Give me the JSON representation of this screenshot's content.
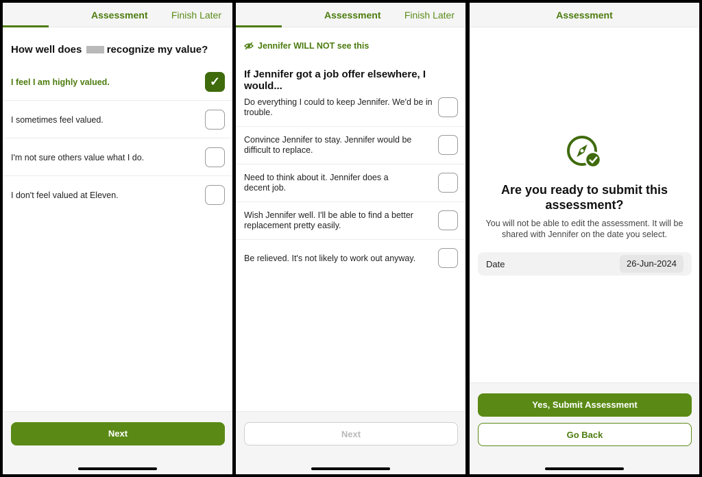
{
  "screens": [
    {
      "title": "Assessment",
      "finish_later": "Finish Later",
      "question_before": "How well does",
      "question_after": "recognize my value?",
      "options": [
        {
          "label": "I feel I am highly valued.",
          "checked": true
        },
        {
          "label": "I sometimes feel valued.",
          "checked": false
        },
        {
          "label": "I'm not sure others value what I do.",
          "checked": false
        },
        {
          "label": "I don't feel valued at Eleven.",
          "checked": false
        }
      ],
      "next_label": "Next"
    },
    {
      "title": "Assessment",
      "finish_later": "Finish Later",
      "visibility_notice": "Jennifer WILL NOT see this",
      "question": "If Jennifer got a job offer elsewhere, I would...",
      "options": [
        {
          "label": "Do everything I could to keep Jennifer. We'd be in trouble.",
          "checked": false
        },
        {
          "label": "Convince Jennifer to stay. Jennifer would be difficult to replace.",
          "checked": false
        },
        {
          "label": "Need to think about it. Jennifer does a decent job.",
          "checked": false
        },
        {
          "label": "Wish Jennifer well. I'll be able to find a better replacement pretty easily.",
          "checked": false
        },
        {
          "label": "Be relieved. It's not likely to work out anyway.",
          "checked": false
        }
      ],
      "next_label": "Next"
    },
    {
      "title": "Assessment",
      "heading": "Are you ready to submit this assessment?",
      "body": "You will not be able to edit the assessment. It will be shared with Jennifer on the date you select.",
      "date_label": "Date",
      "date_value": "26-Jun-2024",
      "submit_label": "Yes, Submit Assessment",
      "back_label": "Go Back"
    }
  ],
  "colors": {
    "accent": "#4d7c0f",
    "button": "#5a8a15"
  },
  "icons": [
    "checkmark-icon",
    "eye-off-icon",
    "compass-check-icon"
  ]
}
